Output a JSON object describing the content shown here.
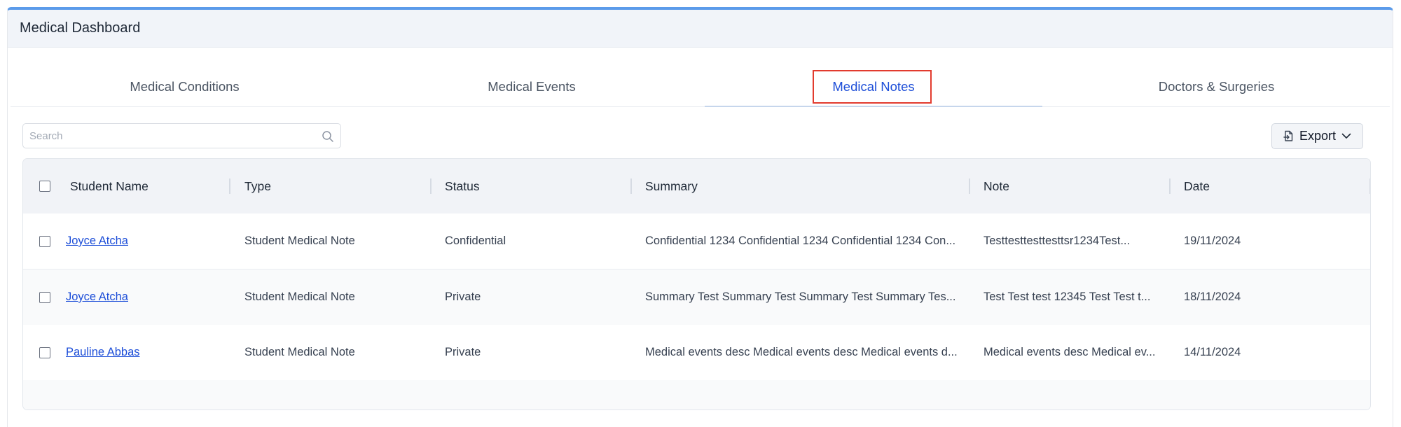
{
  "header": {
    "title": "Medical Dashboard"
  },
  "tabs": [
    {
      "label": "Medical Conditions",
      "active": false
    },
    {
      "label": "Medical Events",
      "active": false
    },
    {
      "label": "Medical Notes",
      "active": true
    },
    {
      "label": "Doctors & Surgeries",
      "active": false
    }
  ],
  "search": {
    "placeholder": "Search",
    "value": ""
  },
  "export": {
    "label": "Export",
    "icon": "file-export-icon"
  },
  "table": {
    "columns": [
      "Student Name",
      "Type",
      "Status",
      "Summary",
      "Note",
      "Date"
    ],
    "rows": [
      {
        "student": "Joyce Atcha",
        "type": "Student Medical Note",
        "status": "Confidential",
        "summary": "Confidential 1234 Confidential 1234 Confidential 1234 Con...",
        "note": "Testtesttesttesttsr1234Test...",
        "date": "19/11/2024"
      },
      {
        "student": "Joyce Atcha",
        "type": "Student Medical Note",
        "status": "Private",
        "summary": "Summary Test Summary Test Summary Test Summary Tes...",
        "note": "Test Test test 12345 Test Test t...",
        "date": "18/11/2024"
      },
      {
        "student": "Pauline Abbas",
        "type": "Student Medical Note",
        "status": "Private",
        "summary": "Medical events desc Medical events desc Medical events d...",
        "note": "Medical events desc Medical ev...",
        "date": "14/11/2024"
      }
    ]
  },
  "colors": {
    "accent": "#1d4ed8",
    "top_border": "#5b9bea",
    "highlight": "#e23b2e"
  }
}
